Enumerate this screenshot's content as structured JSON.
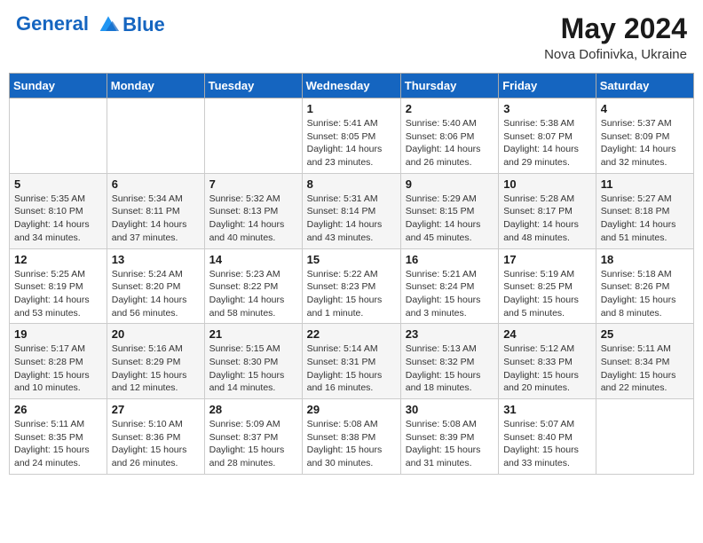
{
  "logo": {
    "line1": "General",
    "line2": "Blue"
  },
  "header": {
    "month": "May 2024",
    "location": "Nova Dofinivka, Ukraine"
  },
  "days_of_week": [
    "Sunday",
    "Monday",
    "Tuesday",
    "Wednesday",
    "Thursday",
    "Friday",
    "Saturday"
  ],
  "weeks": [
    [
      {
        "day": "",
        "info": ""
      },
      {
        "day": "",
        "info": ""
      },
      {
        "day": "",
        "info": ""
      },
      {
        "day": "1",
        "info": "Sunrise: 5:41 AM\nSunset: 8:05 PM\nDaylight: 14 hours and 23 minutes."
      },
      {
        "day": "2",
        "info": "Sunrise: 5:40 AM\nSunset: 8:06 PM\nDaylight: 14 hours and 26 minutes."
      },
      {
        "day": "3",
        "info": "Sunrise: 5:38 AM\nSunset: 8:07 PM\nDaylight: 14 hours and 29 minutes."
      },
      {
        "day": "4",
        "info": "Sunrise: 5:37 AM\nSunset: 8:09 PM\nDaylight: 14 hours and 32 minutes."
      }
    ],
    [
      {
        "day": "5",
        "info": "Sunrise: 5:35 AM\nSunset: 8:10 PM\nDaylight: 14 hours and 34 minutes."
      },
      {
        "day": "6",
        "info": "Sunrise: 5:34 AM\nSunset: 8:11 PM\nDaylight: 14 hours and 37 minutes."
      },
      {
        "day": "7",
        "info": "Sunrise: 5:32 AM\nSunset: 8:13 PM\nDaylight: 14 hours and 40 minutes."
      },
      {
        "day": "8",
        "info": "Sunrise: 5:31 AM\nSunset: 8:14 PM\nDaylight: 14 hours and 43 minutes."
      },
      {
        "day": "9",
        "info": "Sunrise: 5:29 AM\nSunset: 8:15 PM\nDaylight: 14 hours and 45 minutes."
      },
      {
        "day": "10",
        "info": "Sunrise: 5:28 AM\nSunset: 8:17 PM\nDaylight: 14 hours and 48 minutes."
      },
      {
        "day": "11",
        "info": "Sunrise: 5:27 AM\nSunset: 8:18 PM\nDaylight: 14 hours and 51 minutes."
      }
    ],
    [
      {
        "day": "12",
        "info": "Sunrise: 5:25 AM\nSunset: 8:19 PM\nDaylight: 14 hours and 53 minutes."
      },
      {
        "day": "13",
        "info": "Sunrise: 5:24 AM\nSunset: 8:20 PM\nDaylight: 14 hours and 56 minutes."
      },
      {
        "day": "14",
        "info": "Sunrise: 5:23 AM\nSunset: 8:22 PM\nDaylight: 14 hours and 58 minutes."
      },
      {
        "day": "15",
        "info": "Sunrise: 5:22 AM\nSunset: 8:23 PM\nDaylight: 15 hours and 1 minute."
      },
      {
        "day": "16",
        "info": "Sunrise: 5:21 AM\nSunset: 8:24 PM\nDaylight: 15 hours and 3 minutes."
      },
      {
        "day": "17",
        "info": "Sunrise: 5:19 AM\nSunset: 8:25 PM\nDaylight: 15 hours and 5 minutes."
      },
      {
        "day": "18",
        "info": "Sunrise: 5:18 AM\nSunset: 8:26 PM\nDaylight: 15 hours and 8 minutes."
      }
    ],
    [
      {
        "day": "19",
        "info": "Sunrise: 5:17 AM\nSunset: 8:28 PM\nDaylight: 15 hours and 10 minutes."
      },
      {
        "day": "20",
        "info": "Sunrise: 5:16 AM\nSunset: 8:29 PM\nDaylight: 15 hours and 12 minutes."
      },
      {
        "day": "21",
        "info": "Sunrise: 5:15 AM\nSunset: 8:30 PM\nDaylight: 15 hours and 14 minutes."
      },
      {
        "day": "22",
        "info": "Sunrise: 5:14 AM\nSunset: 8:31 PM\nDaylight: 15 hours and 16 minutes."
      },
      {
        "day": "23",
        "info": "Sunrise: 5:13 AM\nSunset: 8:32 PM\nDaylight: 15 hours and 18 minutes."
      },
      {
        "day": "24",
        "info": "Sunrise: 5:12 AM\nSunset: 8:33 PM\nDaylight: 15 hours and 20 minutes."
      },
      {
        "day": "25",
        "info": "Sunrise: 5:11 AM\nSunset: 8:34 PM\nDaylight: 15 hours and 22 minutes."
      }
    ],
    [
      {
        "day": "26",
        "info": "Sunrise: 5:11 AM\nSunset: 8:35 PM\nDaylight: 15 hours and 24 minutes."
      },
      {
        "day": "27",
        "info": "Sunrise: 5:10 AM\nSunset: 8:36 PM\nDaylight: 15 hours and 26 minutes."
      },
      {
        "day": "28",
        "info": "Sunrise: 5:09 AM\nSunset: 8:37 PM\nDaylight: 15 hours and 28 minutes."
      },
      {
        "day": "29",
        "info": "Sunrise: 5:08 AM\nSunset: 8:38 PM\nDaylight: 15 hours and 30 minutes."
      },
      {
        "day": "30",
        "info": "Sunrise: 5:08 AM\nSunset: 8:39 PM\nDaylight: 15 hours and 31 minutes."
      },
      {
        "day": "31",
        "info": "Sunrise: 5:07 AM\nSunset: 8:40 PM\nDaylight: 15 hours and 33 minutes."
      },
      {
        "day": "",
        "info": ""
      }
    ]
  ]
}
